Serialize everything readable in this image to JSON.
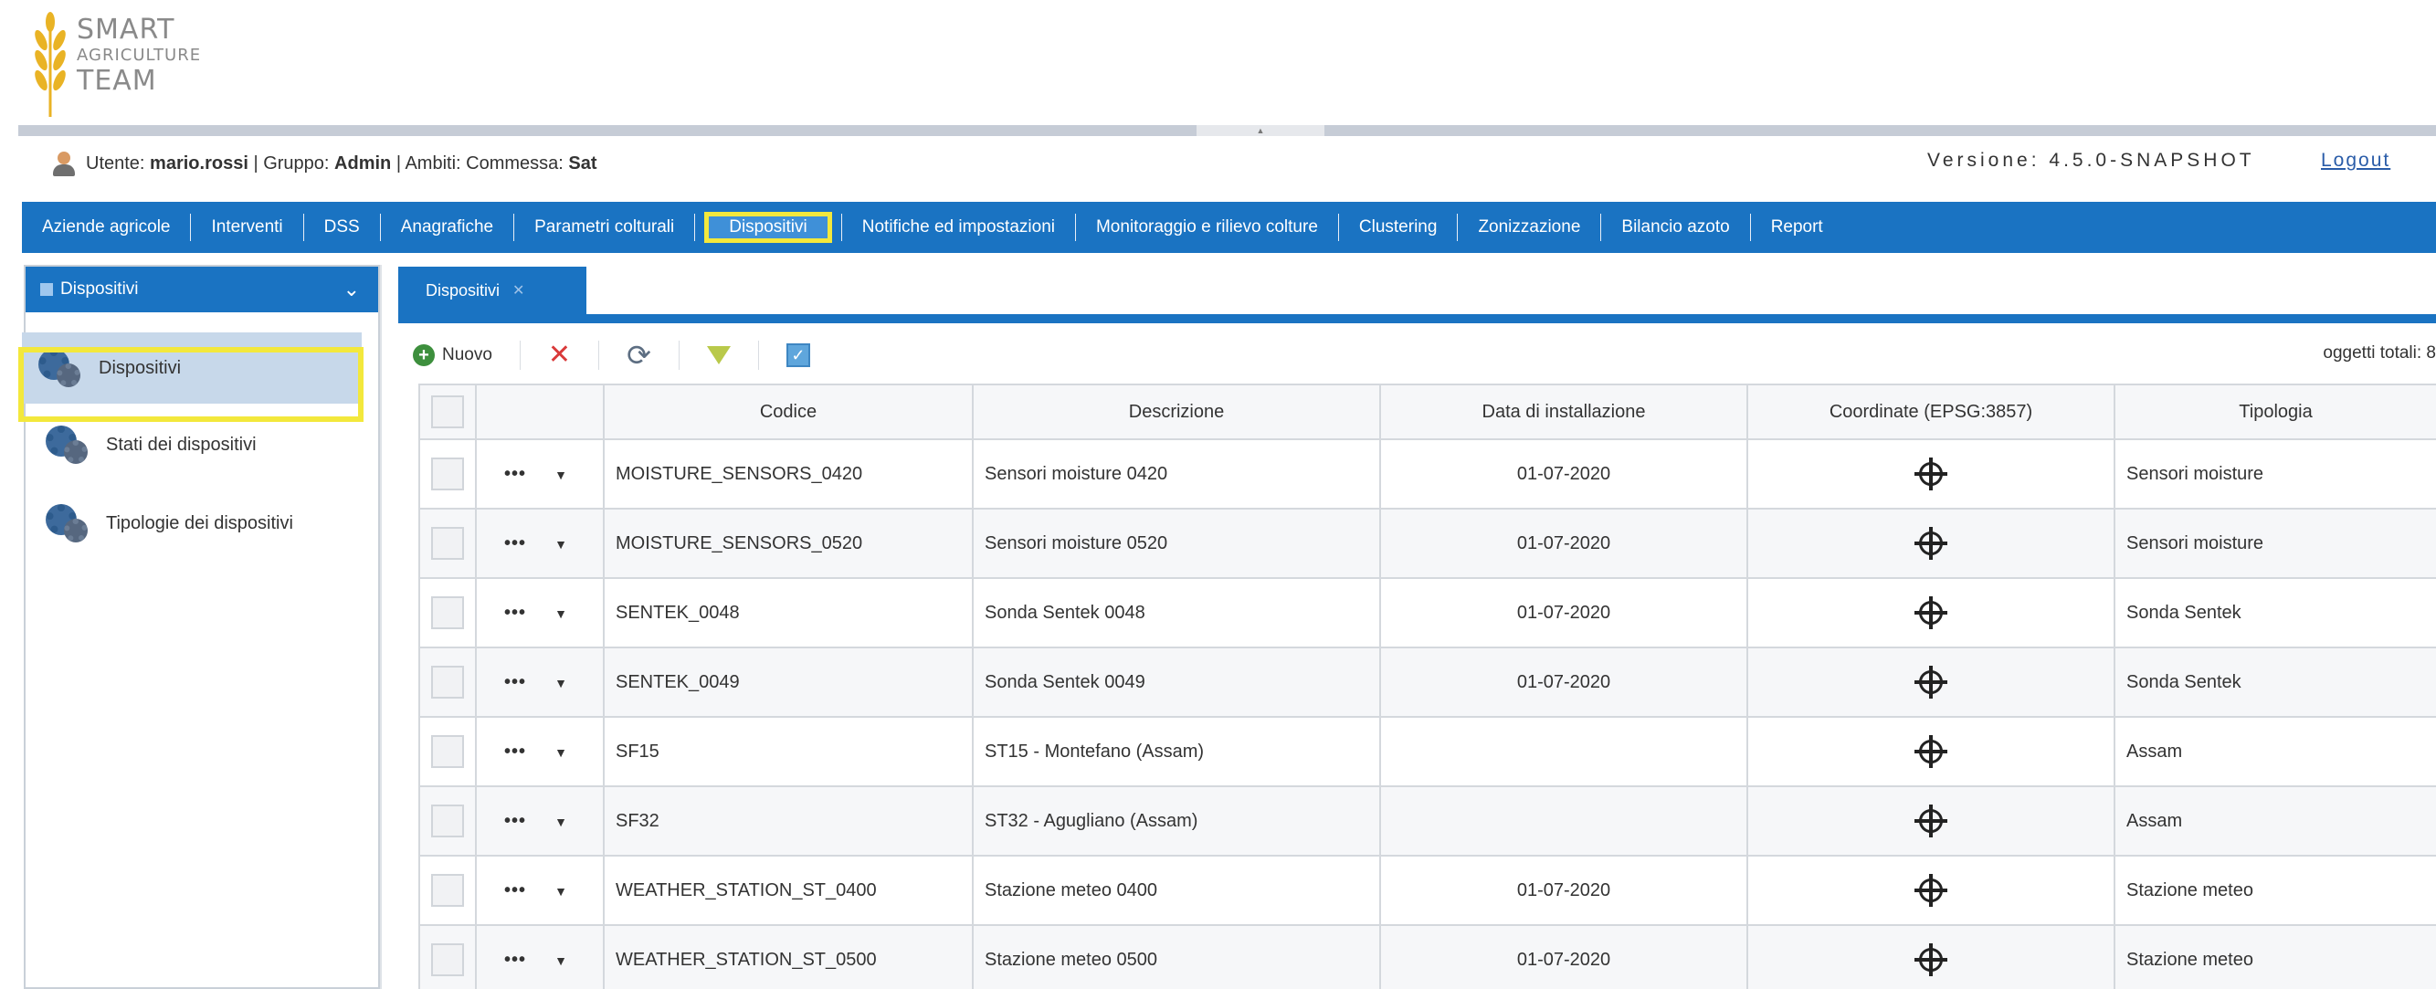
{
  "logo": {
    "line1": "SMART",
    "line2": "AGRICULTURE",
    "line3": "TEAM"
  },
  "userbar": {
    "prefix": "Utente:",
    "username": "mario.rossi",
    "group_label": "| Gruppo:",
    "group": "Admin",
    "scope_label": "| Ambiti: Commessa:",
    "scope": "Sat",
    "version": "Versione: 4.5.0-SNAPSHOT",
    "logout": "Logout"
  },
  "nav": {
    "items": [
      "Aziende agricole",
      "Interventi",
      "DSS",
      "Anagrafiche",
      "Parametri colturali",
      "Dispositivi",
      "Notifiche ed impostazioni",
      "Monitoraggio e rilievo colture",
      "Clustering",
      "Zonizzazione",
      "Bilancio azoto",
      "Report"
    ],
    "active_index": 5
  },
  "left": {
    "header": "Dispositivi",
    "items": [
      "Dispositivi",
      "Stati dei dispositivi",
      "Tipologie dei dispositivi"
    ],
    "active_index": 0
  },
  "tab": {
    "label": "Dispositivi"
  },
  "toolbar": {
    "new_label": "Nuovo",
    "total_label": "oggetti totali: 8"
  },
  "grid": {
    "columns": [
      "Codice",
      "Descrizione",
      "Data di installazione",
      "Coordinate (EPSG:3857)",
      "Tipologia"
    ],
    "rows": [
      {
        "codice": "MOISTURE_SENSORS_0420",
        "descrizione": "Sensori moisture 0420",
        "data": "01-07-2020",
        "tipologia": "Sensori moisture"
      },
      {
        "codice": "MOISTURE_SENSORS_0520",
        "descrizione": "Sensori moisture 0520",
        "data": "01-07-2020",
        "tipologia": "Sensori moisture"
      },
      {
        "codice": "SENTEK_0048",
        "descrizione": "Sonda Sentek 0048",
        "data": "01-07-2020",
        "tipologia": "Sonda Sentek"
      },
      {
        "codice": "SENTEK_0049",
        "descrizione": "Sonda Sentek 0049",
        "data": "01-07-2020",
        "tipologia": "Sonda Sentek"
      },
      {
        "codice": "SF15",
        "descrizione": "ST15 - Montefano (Assam)",
        "data": "",
        "tipologia": "Assam"
      },
      {
        "codice": "SF32",
        "descrizione": "ST32 - Agugliano (Assam)",
        "data": "",
        "tipologia": "Assam"
      },
      {
        "codice": "WEATHER_STATION_ST_0400",
        "descrizione": "Stazione meteo 0400",
        "data": "01-07-2020",
        "tipologia": "Stazione meteo"
      },
      {
        "codice": "WEATHER_STATION_ST_0500",
        "descrizione": "Stazione meteo 0500",
        "data": "01-07-2020",
        "tipologia": "Stazione meteo"
      }
    ],
    "row_menu_icon": "ellipsis-icon",
    "row_expand_icon": "caret-down-icon",
    "coordinate_icon": "crosshair-icon"
  },
  "colors": {
    "nav_blue": "#1a73c2",
    "highlight_yellow": "#f3e83c",
    "logo_gold": "#e9b325"
  }
}
